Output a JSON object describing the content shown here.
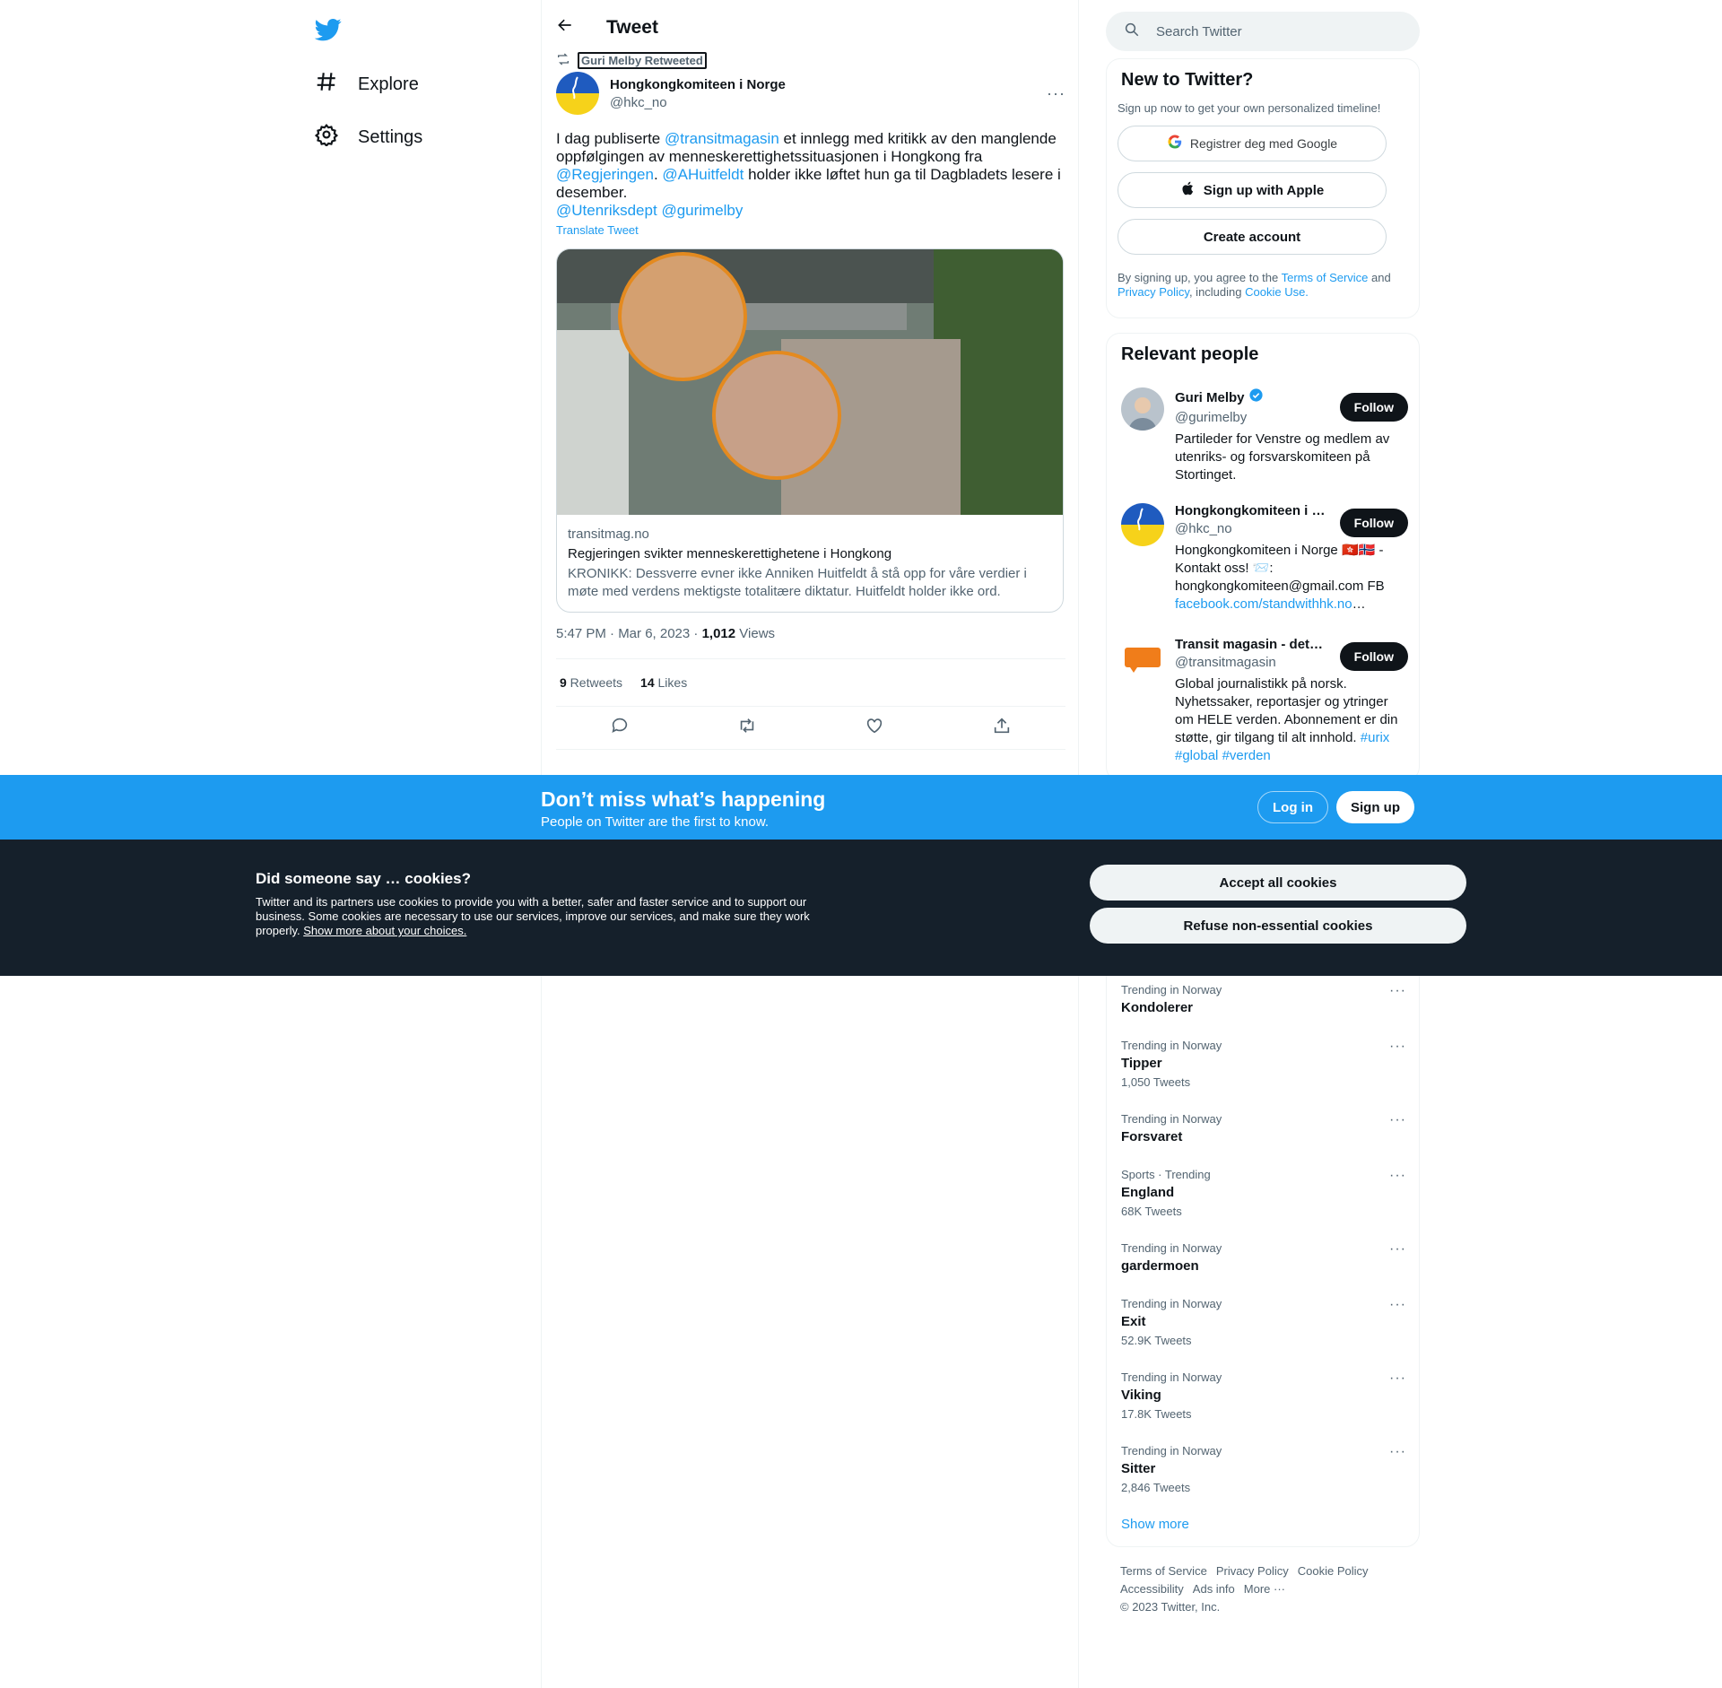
{
  "nav": {
    "logo": "twitter-bird-icon",
    "items": [
      {
        "label": "Explore",
        "icon": "hash-icon"
      },
      {
        "label": "Settings",
        "icon": "gear-icon"
      }
    ]
  },
  "header": {
    "title": "Tweet"
  },
  "tweet": {
    "retweeted_by": "Guri Melby Retweeted",
    "author_name": "Hongkongkomiteen i Norge",
    "author_handle": "@hkc_no",
    "text": {
      "p1": "I dag publiserte ",
      "m1": "@transitmagasin",
      "p2": " et innlegg med kritikk av den manglende oppfølgingen av menneskerettighetssituasjonen i Hongkong fra ",
      "m2": "@Regjeringen",
      "p3": ". ",
      "m3": "@AHuitfeldt",
      "p4": " holder ikke løftet hun ga til Dagbladets lesere i desember.",
      "m4": "@Utenriksdept",
      "m5": "@gurimelby"
    },
    "translate": "Translate Tweet",
    "card": {
      "domain": "transitmag.no",
      "title": "Regjeringen svikter menneskerettighetene i Hongkong",
      "description": "KRONIKK: Dessverre evner ikke Anniken Huitfeldt å stå opp for våre verdier i møte med verdens mektigste totalitære diktatur. Huitfeldt holder ikke ord."
    },
    "time": "5:47 PM · Mar 6, 2023 · ",
    "views_count": "1,012",
    "views_label": " Views",
    "retweets_count": "9",
    "retweets_label": " Retweets",
    "likes_count": "14",
    "likes_label": " Likes"
  },
  "search": {
    "placeholder": "Search Twitter"
  },
  "new_to_twitter": {
    "title": "New to Twitter?",
    "subtitle": "Sign up now to get your own personalized timeline!",
    "google": "Registrer deg med Google",
    "apple": "Sign up with Apple",
    "create": "Create account",
    "legal_1": "By signing up, you agree to the ",
    "terms": "Terms of Service",
    "legal_2": " and ",
    "privacy": "Privacy Policy",
    "legal_3": ", including ",
    "cookie_use": "Cookie Use."
  },
  "relevant_people": {
    "title": "Relevant people",
    "follow": "Follow",
    "people": [
      {
        "name": "Guri Melby",
        "handle": "@gurimelby",
        "verified": true,
        "bio": "Partileder for Venstre og medlem av utenriks- og forsvarskomiteen på Stortinget."
      },
      {
        "name": "Hongkongkomiteen i …",
        "handle": "@hkc_no",
        "bio_1": "Hongkongkomiteen i Norge 🇭🇰🇳🇴 - Kontakt oss! 📨: hongkongkomiteen@gmail.com FB ",
        "bio_link": "facebook.com/standwithhk.no",
        "bio_2": "…"
      },
      {
        "name": "Transit magasin - det…",
        "handle": "@transitmagasin",
        "bio_1": "Global journalistikk på norsk. Nyhetssaker, reportasjer og ytringer om HELE verden. Abonnement er din støtte, gir tilgang til alt innhold. ",
        "tag1": "#urix",
        "tag2": "#global",
        "tag3": "#verden"
      }
    ]
  },
  "trends": {
    "items": [
      {
        "context": "Trending in Norway",
        "name": "Kondolerer",
        "count": ""
      },
      {
        "context": "Trending in Norway",
        "name": "Tipper",
        "count": "1,050 Tweets"
      },
      {
        "context": "Trending in Norway",
        "name": "Forsvaret",
        "count": ""
      },
      {
        "context": "Sports · Trending",
        "name": "England",
        "count": "68K Tweets"
      },
      {
        "context": "Trending in Norway",
        "name": "gardermoen",
        "count": ""
      },
      {
        "context": "Trending in Norway",
        "name": "Exit",
        "count": "52.9K Tweets"
      },
      {
        "context": "Trending in Norway",
        "name": "Viking",
        "count": "17.8K Tweets"
      },
      {
        "context": "Trending in Norway",
        "name": "Sitter",
        "count": "2,846 Tweets"
      }
    ],
    "show_more": "Show more"
  },
  "footer": {
    "links": [
      "Terms of Service",
      "Privacy Policy",
      "Cookie Policy",
      "Accessibility",
      "Ads info",
      "More ···"
    ],
    "copyright": "© 2023 Twitter, Inc."
  },
  "banner": {
    "title": "Don’t miss what’s happening",
    "subtitle": "People on Twitter are the first to know.",
    "login": "Log in",
    "signup": "Sign up"
  },
  "cookies": {
    "title": "Did someone say … cookies?",
    "text": "Twitter and its partners use cookies to provide you with a better, safer and faster service and to support our business. Some cookies are necessary to use our services, improve our services, and make sure they work properly. ",
    "link": "Show more about your choices.",
    "accept": "Accept all cookies",
    "refuse": "Refuse non-essential cookies"
  },
  "colors": {
    "accent": "#1d9bf0",
    "text": "#0f1419",
    "muted": "#536471",
    "cookie_bg": "#15202b"
  }
}
